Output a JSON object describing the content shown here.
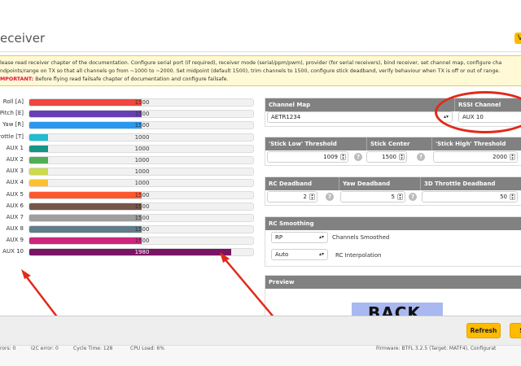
{
  "header": {
    "title": "eceiver",
    "pill": "V"
  },
  "notice": {
    "line1": "lease read receiver chapter of the documentation. Configure serial port (if required), receiver mode (serial/ppm/pwm), provider (for serial receivers), bind receiver, set channel map, configure cha",
    "line2": "ndpoints/range on TX so that all channels go from ~1000 to ~2000. Set midpoint (default 1500), trim channels to 1500, configure stick deadband, verify behaviour when TX is off or out of range.",
    "important_label": "MPORTANT:",
    "line3": " Before flying read failsafe chapter of documentation and configure failsafe."
  },
  "channels": [
    {
      "label": "Roll [A]",
      "value": 1500,
      "display": "1500",
      "color": "#f1453d"
    },
    {
      "label": "Pitch [E]",
      "value": 1500,
      "display": "1500",
      "color": "#673fb4"
    },
    {
      "label": "Yaw [R]",
      "value": 1500,
      "display": "1500",
      "color": "#2b98f0"
    },
    {
      "label": "rottle [T]",
      "value": 1000,
      "display": "1000",
      "color": "#1fbcd2"
    },
    {
      "label": "AUX 1",
      "value": 1000,
      "display": "1000",
      "color": "#159588"
    },
    {
      "label": "AUX 2",
      "value": 1000,
      "display": "1000",
      "color": "#50ae55"
    },
    {
      "label": "AUX 3",
      "value": 1000,
      "display": "1000",
      "color": "#cdda49"
    },
    {
      "label": "AUX 4",
      "value": 1000,
      "display": "1000",
      "color": "#fdc02f"
    },
    {
      "label": "AUX 5",
      "value": 1500,
      "display": "1500",
      "color": "#fc5830"
    },
    {
      "label": "AUX 6",
      "value": 1500,
      "display": "1500",
      "color": "#785549"
    },
    {
      "label": "AUX 7",
      "value": 1500,
      "display": "1500",
      "color": "#9e9e9e"
    },
    {
      "label": "AUX 8",
      "value": 1500,
      "display": "1500",
      "color": "#617d8a"
    },
    {
      "label": "AUX 9",
      "value": 1500,
      "display": "1500",
      "color": "#cf267d"
    },
    {
      "label": "AUX 10",
      "value": 1980,
      "display": "1980",
      "color": "#7a1464"
    }
  ],
  "channel_map": {
    "title": "Channel Map",
    "value": "AETR1234"
  },
  "rssi": {
    "title": "RSSI Channel",
    "value": "AUX 10"
  },
  "thresholds": {
    "low_title": "'Stick Low' Threshold",
    "low_value": "1009",
    "center_title": "Stick Center",
    "center_value": "1500",
    "high_title": "'Stick High' Threshold",
    "high_value": "2000"
  },
  "deadband": {
    "rc_title": "RC Deadband",
    "rc_value": "2",
    "yaw_title": "Yaw Deadband",
    "yaw_value": "5",
    "throttle_title": "3D Throttle Deadband",
    "throttle_value": "50"
  },
  "smoothing": {
    "title": "RC Smoothing",
    "channels_select": "RP",
    "channels_label": "Channels Smoothed",
    "interp_select": "Auto",
    "interp_label": "RC Interpolation"
  },
  "preview": {
    "title": "Preview",
    "image_text": "BACK"
  },
  "toolbar": {
    "refresh_label": "Refresh",
    "save_label": "S"
  },
  "status": {
    "s1": "rors: 0",
    "s2": "I2C error: 0",
    "s3": "Cycle Time: 128",
    "s4": "CPU Load: 6%",
    "s5": "Firmware: BTFL 3.2.5 (Target: MATF4), Configurat"
  },
  "colors": {
    "accent": "#ffbb00",
    "panel_header": "#818181",
    "annotation": "#e02a1a"
  }
}
